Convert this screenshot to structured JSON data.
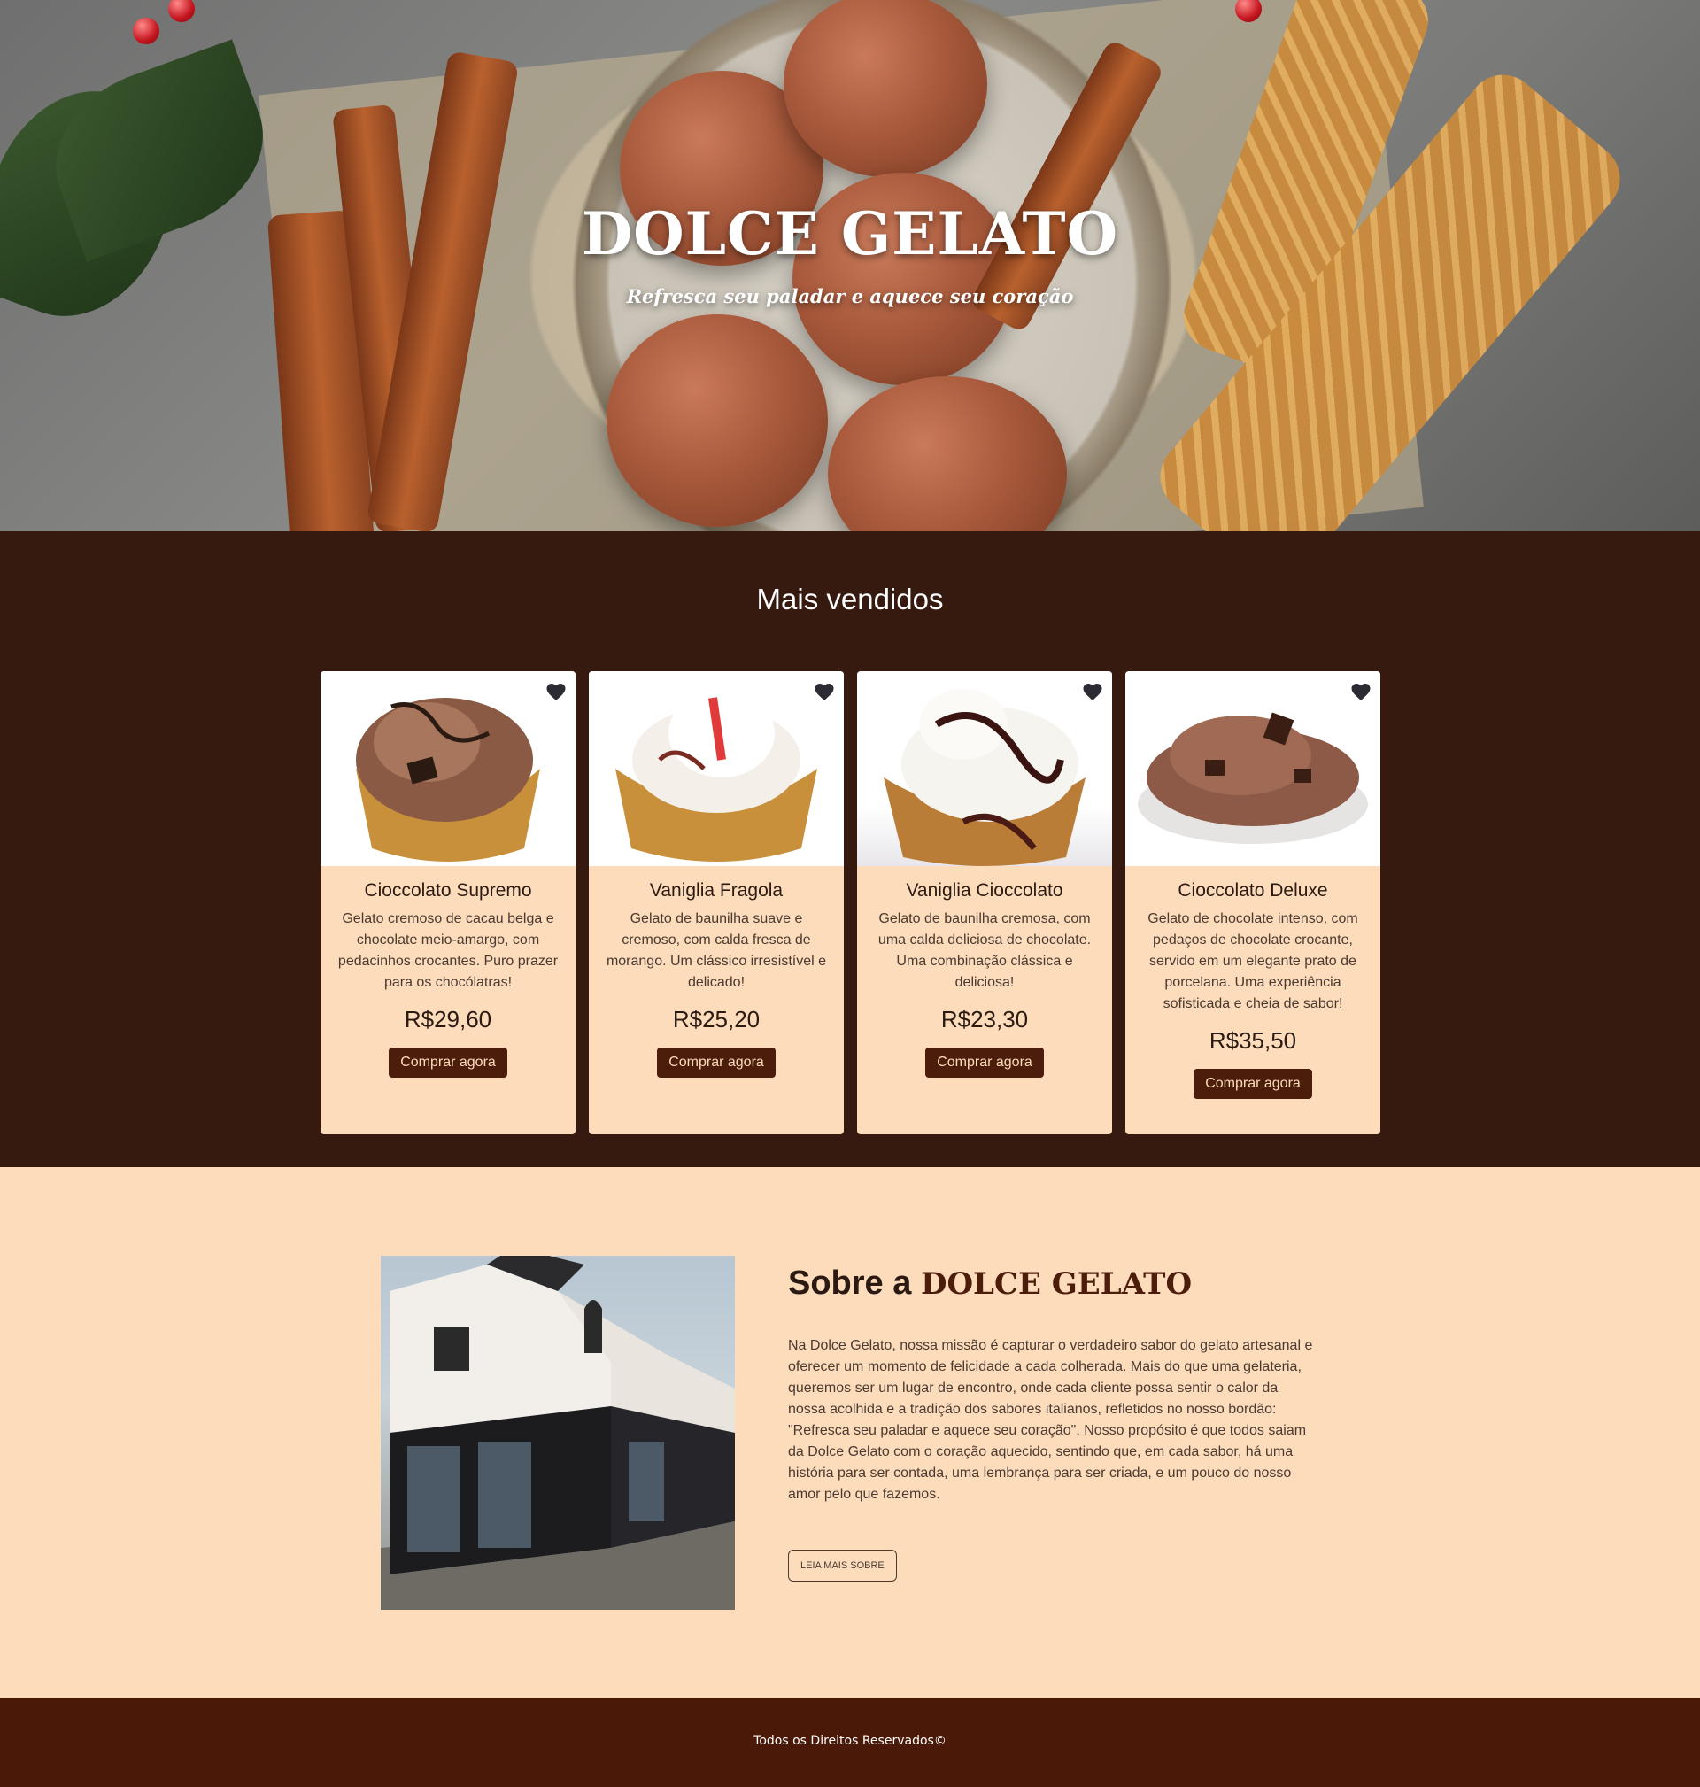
{
  "hero": {
    "title": "DOLCE GELATO",
    "subtitle": "Refresca seu paladar e aquece seu coração"
  },
  "bestsellers": {
    "title": "Mais vendidos",
    "buy_label": "Comprar agora",
    "products": [
      {
        "name": "Cioccolato Supremo",
        "description": "Gelato cremoso de cacau belga e chocolate meio-amargo, com pedacinhos crocantes. Puro prazer para os chocólatras!",
        "price": "R$29,60"
      },
      {
        "name": "Vaniglia Fragola",
        "description": "Gelato de baunilha suave e cremoso, com calda fresca de morango. Um clássico irresistível e delicado!",
        "price": "R$25,20"
      },
      {
        "name": "Vaniglia Cioccolato",
        "description": "Gelato de baunilha cremosa, com uma calda deliciosa de chocolate. Uma combinação clássica e deliciosa!",
        "price": "R$23,30"
      },
      {
        "name": "Cioccolato Deluxe",
        "description": "Gelato de chocolate intenso, com pedaços de chocolate crocante, servido em um elegante prato de porcelana. Uma experiência sofisticada e cheia de sabor!",
        "price": "R$35,50"
      }
    ]
  },
  "about": {
    "heading_prefix": "Sobre a",
    "heading_brand": "DOLCE GELATO",
    "text": "Na Dolce Gelato, nossa missão é capturar o verdadeiro sabor do gelato artesanal e oferecer um momento de felicidade a cada colherada. Mais do que uma gelateria, queremos ser um lugar de encontro, onde cada cliente possa sentir o calor da nossa acolhida e a tradição dos sabores italianos, refletidos no nosso bordão: \"Refresca seu paladar e aquece seu coração\". Nosso propósito é que todos saiam da Dolce Gelato com o coração aquecido, sentindo que, em cada sabor, há uma história para ser contada, uma lembrança para ser criada, e um pouco do nosso amor pelo que fazemos.",
    "button_label": "LEIA MAIS SOBRE"
  },
  "footer": {
    "text": "Todos os Direitos Reservados©"
  },
  "colors": {
    "dark_brown": "#361a0f",
    "button_brown": "#4c1d0b",
    "peach": "#fddcbc",
    "footer": "#4a1908"
  },
  "icons": {
    "favorite": "heart-icon"
  }
}
